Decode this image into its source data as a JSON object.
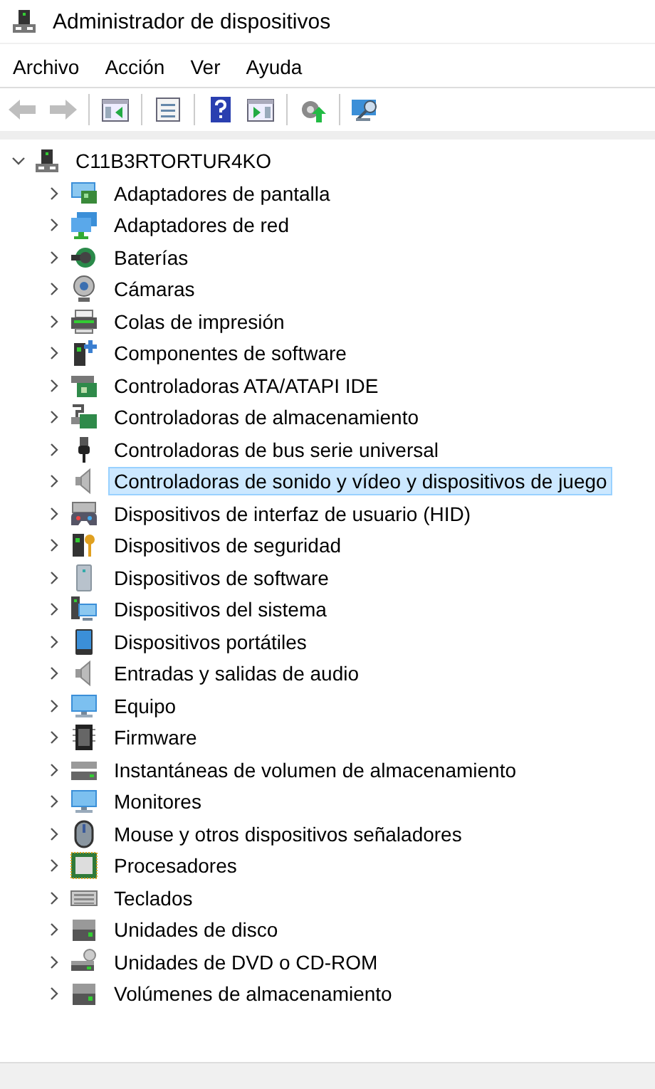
{
  "window": {
    "title": "Administrador de dispositivos"
  },
  "menu": [
    "Archivo",
    "Acción",
    "Ver",
    "Ayuda"
  ],
  "toolbar": [
    [
      {
        "kind": "back",
        "disabled": true
      },
      {
        "kind": "forward",
        "disabled": true
      }
    ],
    [
      {
        "kind": "console",
        "disabled": false
      }
    ],
    [
      {
        "kind": "properties",
        "disabled": false
      }
    ],
    [
      {
        "kind": "help",
        "disabled": false
      },
      {
        "kind": "pane",
        "disabled": false
      }
    ],
    [
      {
        "kind": "update",
        "disabled": false
      }
    ],
    [
      {
        "kind": "scan",
        "disabled": false
      }
    ]
  ],
  "tree": {
    "label": "C11B3RTORTUR4KO",
    "expanded": true,
    "children": [
      {
        "label": "Adaptadores de pantalla",
        "kind": "display",
        "expanded": false,
        "selected": false
      },
      {
        "label": "Adaptadores de red",
        "kind": "network",
        "expanded": false,
        "selected": false
      },
      {
        "label": "Baterías",
        "kind": "battery",
        "expanded": false,
        "selected": false
      },
      {
        "label": "Cámaras",
        "kind": "camera",
        "expanded": false,
        "selected": false
      },
      {
        "label": "Colas de impresión",
        "kind": "printer",
        "expanded": false,
        "selected": false
      },
      {
        "label": "Componentes de software",
        "kind": "software",
        "expanded": false,
        "selected": false
      },
      {
        "label": "Controladoras ATA/ATAPI IDE",
        "kind": "board",
        "expanded": false,
        "selected": false
      },
      {
        "label": "Controladoras de almacenamiento",
        "kind": "storage",
        "expanded": false,
        "selected": false
      },
      {
        "label": "Controladoras de bus serie universal",
        "kind": "usb",
        "expanded": false,
        "selected": false
      },
      {
        "label": "Controladoras de sonido y vídeo y dispositivos de juego",
        "kind": "speaker",
        "expanded": false,
        "selected": true
      },
      {
        "label": "Dispositivos de interfaz de usuario (HID)",
        "kind": "hid",
        "expanded": false,
        "selected": false
      },
      {
        "label": "Dispositivos de seguridad",
        "kind": "security",
        "expanded": false,
        "selected": false
      },
      {
        "label": "Dispositivos de software",
        "kind": "tower",
        "expanded": false,
        "selected": false
      },
      {
        "label": "Dispositivos del sistema",
        "kind": "system",
        "expanded": false,
        "selected": false
      },
      {
        "label": "Dispositivos portátiles",
        "kind": "portable",
        "expanded": false,
        "selected": false
      },
      {
        "label": "Entradas y salidas de audio",
        "kind": "speaker",
        "expanded": false,
        "selected": false
      },
      {
        "label": "Equipo",
        "kind": "monitor",
        "expanded": false,
        "selected": false
      },
      {
        "label": "Firmware",
        "kind": "chip",
        "expanded": false,
        "selected": false
      },
      {
        "label": "Instantáneas de volumen de almacenamiento",
        "kind": "disks",
        "expanded": false,
        "selected": false
      },
      {
        "label": "Monitores",
        "kind": "monitor",
        "expanded": false,
        "selected": false
      },
      {
        "label": "Mouse y otros dispositivos señaladores",
        "kind": "mouse",
        "expanded": false,
        "selected": false
      },
      {
        "label": "Procesadores",
        "kind": "cpu",
        "expanded": false,
        "selected": false
      },
      {
        "label": "Teclados",
        "kind": "keyboard",
        "expanded": false,
        "selected": false
      },
      {
        "label": "Unidades de disco",
        "kind": "drive",
        "expanded": false,
        "selected": false
      },
      {
        "label": "Unidades de DVD o CD-ROM",
        "kind": "dvd",
        "expanded": false,
        "selected": false
      },
      {
        "label": "Volúmenes de almacenamiento",
        "kind": "drive",
        "expanded": false,
        "selected": false
      }
    ]
  }
}
